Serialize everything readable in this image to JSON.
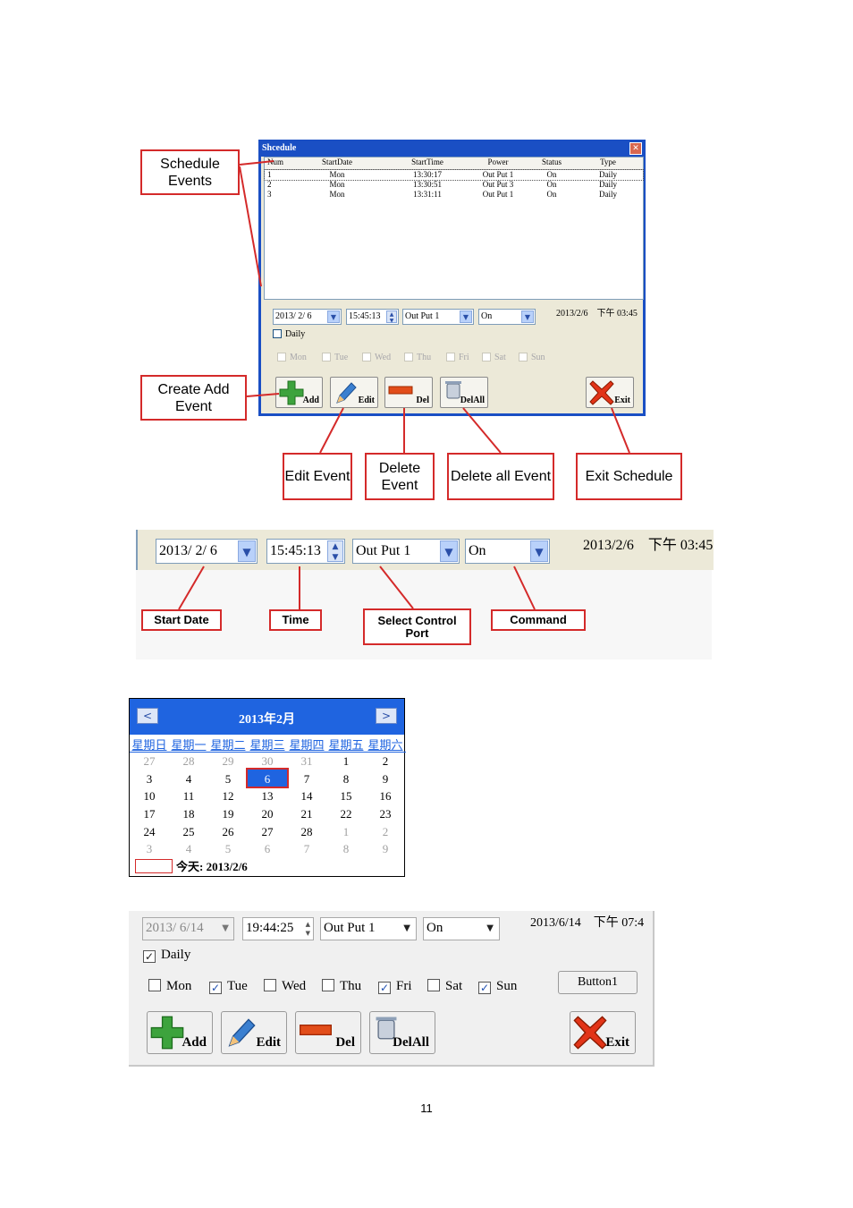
{
  "dialog": {
    "title": "Shcedule",
    "close": "✕",
    "columns": [
      "Num",
      "StartDate",
      "StartTime",
      "Power",
      "Status",
      "Type"
    ],
    "rows": [
      [
        "1",
        "Mon",
        "13:30:17",
        "Out Put 1",
        "On",
        "Daily"
      ],
      [
        "2",
        "Mon",
        "13:30:51",
        "Out Put 3",
        "On",
        "Daily"
      ],
      [
        "3",
        "Mon",
        "13:31:11",
        "Out Put 1",
        "On",
        "Daily"
      ]
    ],
    "date": "2013/ 2/ 6",
    "time": "15:45:13",
    "port": "Out Put 1",
    "command": "On",
    "clock": "2013/2/6　下午 03:45",
    "daily": "Daily",
    "days": [
      "Mon",
      "Tue",
      "Wed",
      "Thu",
      "Fri",
      "Sat",
      "Sun"
    ],
    "buttons": {
      "add": "Add",
      "edit": "Edit",
      "del": "Del",
      "delall": "DelAll",
      "exit": "Exit"
    }
  },
  "callouts": {
    "schedule_events": "Schedule Events",
    "create_add_event": "Create Add Event",
    "edit_event": "Edit Event",
    "delete_event": "Delete Event",
    "delete_all_event": "Delete all Event",
    "exit_schedule": "Exit Schedule",
    "start_date": "Start Date",
    "time": "Time",
    "select_control_port": "Select Control Port",
    "command": "Command"
  },
  "strip": {
    "date": "2013/ 2/ 6",
    "time": "15:45:13",
    "port": "Out Put 1",
    "command": "On",
    "clock": "2013/2/6　下午 03:45"
  },
  "calendar": {
    "title": "2013年2月",
    "prev": "<",
    "next": ">",
    "weekdays": [
      "星期日",
      "星期一",
      "星期二",
      "星期三",
      "星期四",
      "星期五",
      "星期六"
    ],
    "weeks": [
      [
        "27",
        "28",
        "29",
        "30",
        "31",
        "1",
        "2"
      ],
      [
        "3",
        "4",
        "5",
        "6",
        "7",
        "8",
        "9"
      ],
      [
        "10",
        "11",
        "12",
        "13",
        "14",
        "15",
        "16"
      ],
      [
        "17",
        "18",
        "19",
        "20",
        "21",
        "22",
        "23"
      ],
      [
        "24",
        "25",
        "26",
        "27",
        "28",
        "1",
        "2"
      ],
      [
        "3",
        "4",
        "5",
        "6",
        "7",
        "8",
        "9"
      ]
    ],
    "today": "今天: 2013/2/6"
  },
  "zoom": {
    "date": "2013/  6/14",
    "time": "19:44:25",
    "port": "Out Put 1",
    "command": "On",
    "clock": "2013/6/14　下午 07:4",
    "daily": "Daily",
    "days": [
      "Mon",
      "Tue",
      "Wed",
      "Thu",
      "Fri",
      "Sat",
      "Sun"
    ],
    "checked": [
      "Tue",
      "Fri",
      "Sun"
    ],
    "button1": "Button1",
    "buttons": {
      "add": "Add",
      "edit": "Edit",
      "del": "Del",
      "delall": "DelAll",
      "exit": "Exit"
    }
  },
  "page_number": "11"
}
